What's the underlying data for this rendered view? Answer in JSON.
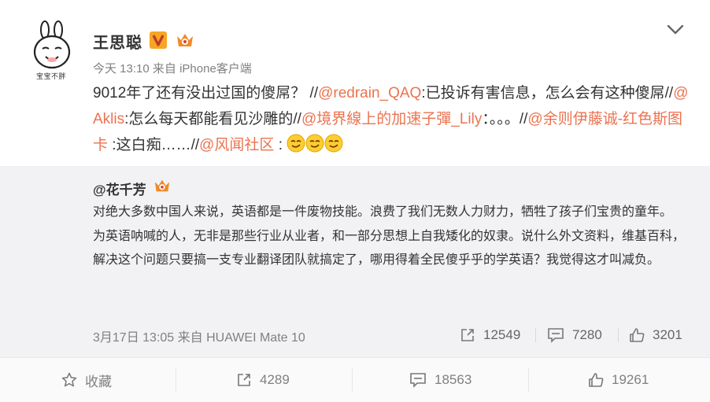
{
  "post": {
    "author": "王思聪",
    "avatar_caption": "宝宝不胖",
    "time": "今天 13:10",
    "source_prefix": "来自",
    "source": "iPhone客户端",
    "verified_icon": "v-verified-icon",
    "member_icon": "vip-crown-icon",
    "menu_icon": "chevron-down-icon",
    "text": {
      "t1": "9012年了还有没出过国的傻屌？ //",
      "m1": "@redrain_QAQ",
      "t2": ":已投诉有害信息，怎么会有这种傻屌//",
      "m2": "@Aklis",
      "t3": ":怎么每天都能看见沙雕的//",
      "m3": "@境界線上的加速子彈_Lily",
      "t4": "：。。。//",
      "m4": "@余则伊藤诚-红色斯图卡",
      "t5": " :这白痴……//",
      "m5": "@风闻社区",
      "t6": " : ",
      "emoji_icon": "smirk-emoji-icon"
    }
  },
  "repost": {
    "author": "@花千芳",
    "member_icon": "vip-crown-icon",
    "paragraph1": "对绝大多数中国人来说，英语都是一件废物技能。浪费了我们无数人力财力，牺牲了孩子们宝贵的童年。",
    "paragraph2": "为英语呐喊的人，无非是那些行业从业者，和一部分思想上自我矮化的奴隶。说什么外文资料，维基百科，解决这个问题只要搞一支专业翻译团队就搞定了，哪用得着全民傻乎乎的学英语？我觉得这才叫减负。",
    "time": "3月17日 13:05",
    "source_prefix": "来自",
    "source": "HUAWEI Mate 10",
    "reposts": "12549",
    "comments": "7280",
    "likes": "3201"
  },
  "actions": {
    "favorite_label": "收藏",
    "repost_count": "4289",
    "comment_count": "18563",
    "like_count": "19261"
  },
  "colors": {
    "mention": "#eb7350",
    "repost_bg": "#f2f2f5",
    "vip_orange": "#f08a24"
  }
}
